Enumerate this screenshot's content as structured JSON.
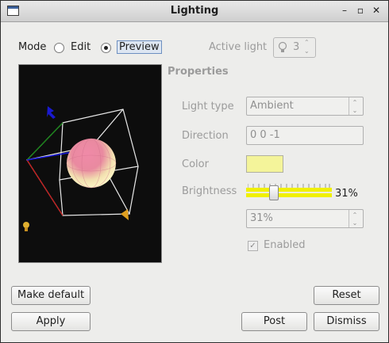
{
  "window": {
    "title": "Lighting"
  },
  "mode": {
    "label": "Mode",
    "options": [
      "Edit",
      "Preview"
    ],
    "selected": "Preview"
  },
  "active_light": {
    "label": "Active light",
    "value": "3"
  },
  "properties": {
    "heading": "Properties",
    "light_type": {
      "label": "Light type",
      "value": "Ambient"
    },
    "direction": {
      "label": "Direction",
      "value": "0 0 -1"
    },
    "color": {
      "label": "Color",
      "value": "#f4f49a"
    },
    "brightness": {
      "label": "Brightness",
      "slider_percent": "31%",
      "field_value": "31%",
      "level": 0.31
    },
    "enabled": {
      "label": "Enabled",
      "checked": true
    }
  },
  "buttons": {
    "make_default": "Make default",
    "reset": "Reset",
    "apply": "Apply",
    "post": "Post",
    "dismiss": "Dismiss"
  },
  "colors": {
    "accent": "#f4f49a",
    "slider_fill": "#f0f000",
    "canvas_bg": "#0d0d0d"
  }
}
